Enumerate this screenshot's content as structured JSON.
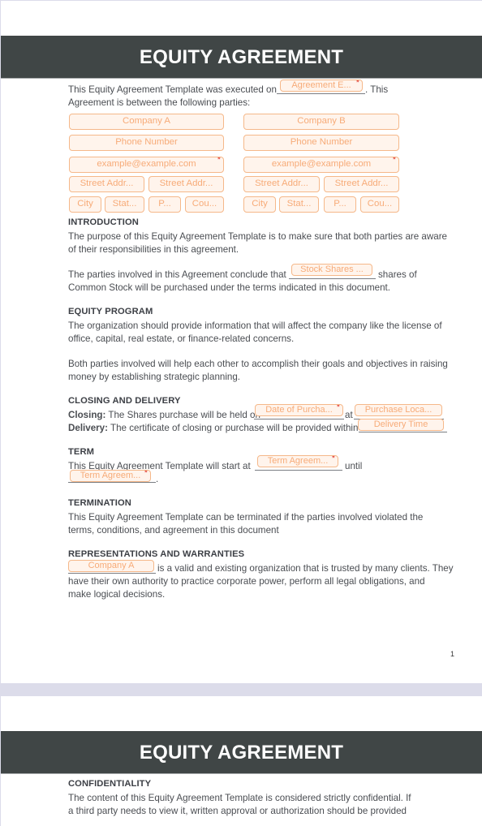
{
  "document": {
    "title": "EQUITY AGREEMENT",
    "page_number": "1"
  },
  "intro_line": {
    "before": "This Equity Agreement Template was executed on",
    "after": ". This",
    "line2": "Agreement is between the following parties:",
    "field": {
      "placeholder": "Agreement E...",
      "required": true
    }
  },
  "parties": {
    "a": {
      "company": "Company A",
      "phone": "Phone Number",
      "email": "example@example.com",
      "street1": "Street Addr...",
      "street2": "Street Addr...",
      "city": "City",
      "state": "Stat...",
      "postal": "P...",
      "country": "Cou..."
    },
    "b": {
      "company": "Company B",
      "phone": "Phone Number",
      "email": "example@example.com",
      "street1": "Street Addr...",
      "street2": "Street Addr...",
      "city": "City",
      "state": "Stat...",
      "postal": "P...",
      "country": "Cou..."
    },
    "required_marker": "*"
  },
  "sections": {
    "introduction": {
      "heading": "INTRODUCTION",
      "p1_l1": "The purpose of this Equity Agreement Template is to make sure that both parties are aware",
      "p1_l2": "of their responsibilities in this agreement.",
      "p2_before": "The parties involved in this Agreement conclude that",
      "p2_field": "Stock Shares ...",
      "p2_after": "shares of",
      "p2_l2": "Common Stock will be purchased under the terms indicated in this document."
    },
    "equity_program": {
      "heading": "EQUITY PROGRAM",
      "p1_l1": "The organization should provide information that will affect the company like the license of",
      "p1_l2": "office, capital, real estate, or finance-related concerns.",
      "p2_l1": "Both parties involved will help each other to accomplish their goals and objectives in raising",
      "p2_l2": "money by establishing strategic planning."
    },
    "closing": {
      "heading": "CLOSING AND DELIVERY",
      "closing_label": "Closing:",
      "closing_text": "The Shares purchase will be held on",
      "date_field": "Date of Purcha...",
      "at": "at",
      "location_field": "Purchase Loca...",
      "delivery_label": "Delivery:",
      "delivery_text": "The certificate of closing or purchase will be provided within",
      "delivery_field": "Delivery Time"
    },
    "term": {
      "heading": "TERM",
      "text_before": "This Equity Agreement Template will start at",
      "start_field": "Term Agreem...",
      "until": "until",
      "end_field": "Term Agreem...",
      "end_punct": "."
    },
    "termination": {
      "heading": "TERMINATION",
      "l1": "This Equity Agreement Template can be terminated if the parties involved violated the",
      "l2": "terms, conditions, and agreement in this document"
    },
    "representations": {
      "heading": "REPRESENTATIONS AND WARRANTIES",
      "company_field": "Company A",
      "l1_after": "is a valid and existing organization that is trusted by many clients. They",
      "l2": "have their own authority to practice corporate power, perform all legal obligations, and",
      "l3": "make logical decisions."
    },
    "confidentiality": {
      "heading": "CONFIDENTIALITY",
      "l1": "The content of this Equity Agreement Template is considered strictly confidential. If",
      "l2": "a third party needs to view it, written approval or authorization should be provided"
    }
  },
  "colors": {
    "banner": "#404646",
    "field_border": "#f5b88a",
    "field_bg": "#fff4ec",
    "field_text": "#f7ab78",
    "required": "#e0342c",
    "backdrop": "#dcdcea"
  }
}
